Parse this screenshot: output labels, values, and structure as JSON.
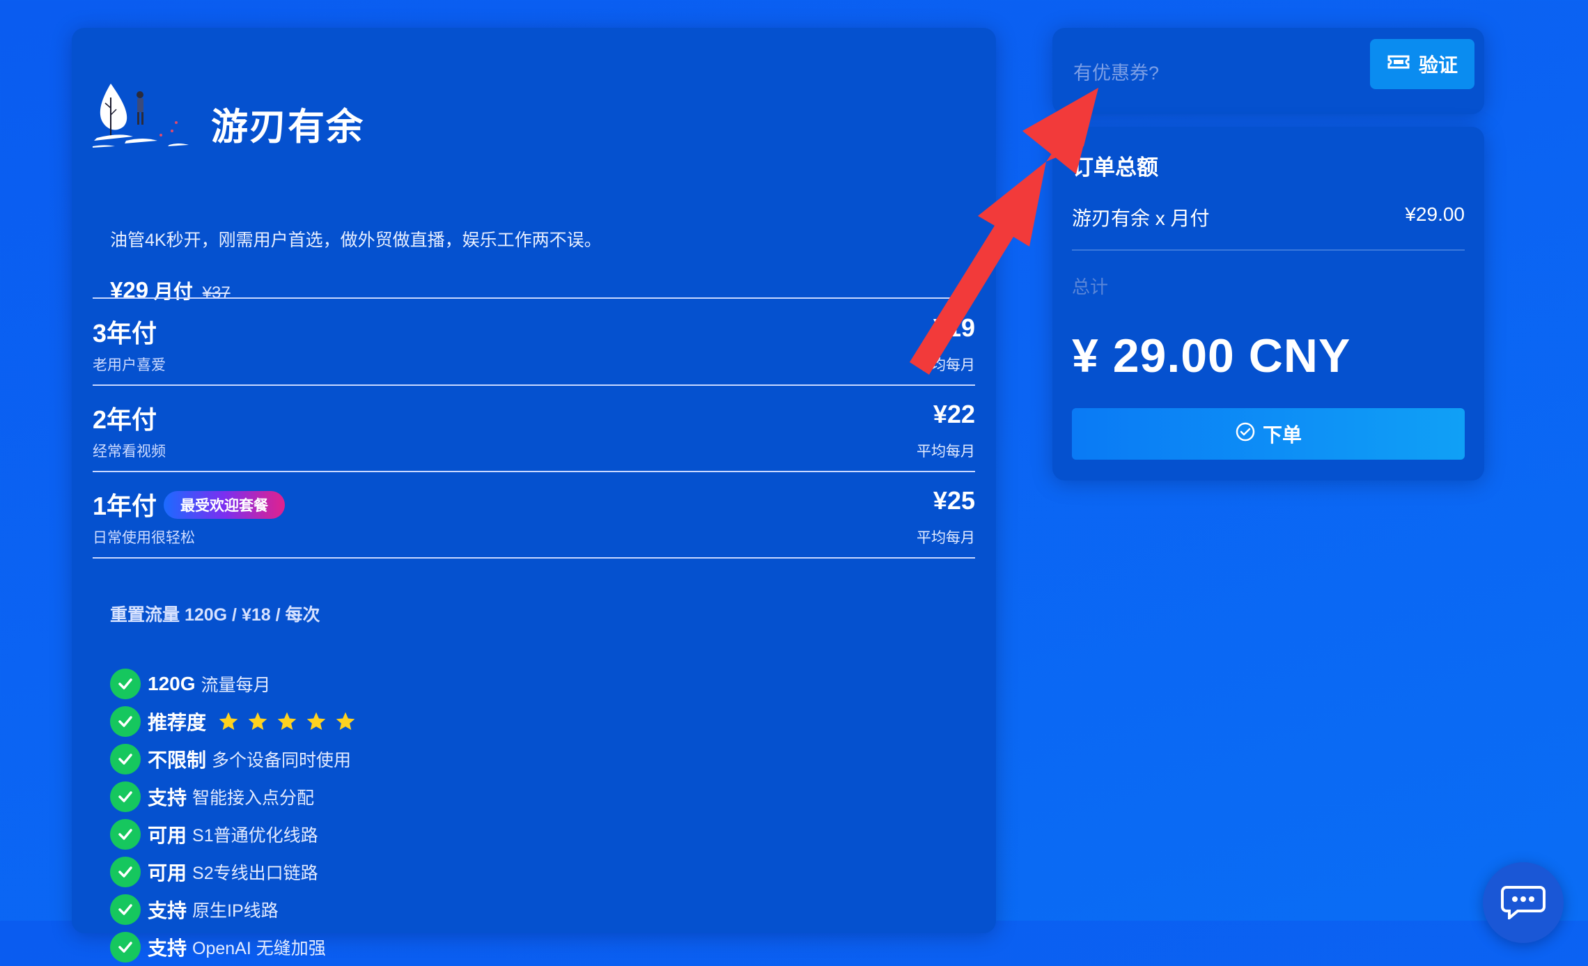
{
  "product": {
    "title": "游刃有余",
    "description": "油管4K秒开，刚需用户首选，做外贸做直播，娱乐工作两不误。",
    "price": "¥29",
    "period": "月付",
    "original_price": "¥37"
  },
  "plans": [
    {
      "name": "3年付",
      "subtitle": "老用户喜爱",
      "price": "¥19",
      "per": "平均每月"
    },
    {
      "name": "2年付",
      "subtitle": "经常看视频",
      "price": "¥22",
      "per": "平均每月"
    },
    {
      "name": "1年付",
      "badge": "最受欢迎套餐",
      "subtitle": "日常使用很轻松",
      "price": "¥25",
      "per": "平均每月"
    }
  ],
  "reset_traffic": "重置流量 120G / ¥18 / 每次",
  "features": [
    {
      "strong": "120G",
      "text": "流量每月"
    },
    {
      "strong": "推荐度",
      "text": "",
      "stars": 5
    },
    {
      "strong": "不限制",
      "text": "多个设备同时使用"
    },
    {
      "strong": "支持",
      "text": "智能接入点分配"
    },
    {
      "strong": "可用",
      "text": "S1普通优化线路"
    },
    {
      "strong": "可用",
      "text": "S2专线出口链路"
    },
    {
      "strong": "支持",
      "text": "原生IP线路"
    },
    {
      "strong": "支持",
      "text": "OpenAI 无缝加强"
    }
  ],
  "coupon": {
    "placeholder": "有优惠券?",
    "verify_label": "验证"
  },
  "order": {
    "title": "订单总额",
    "item": "游刃有余 x 月付",
    "item_price": "¥29.00",
    "total_label": "总计",
    "total_amount": "¥ 29.00 CNY",
    "submit_label": "下单"
  },
  "colors": {
    "background": "#0a5cf0",
    "panel": "#0551cf",
    "check": "#16c75e",
    "star": "#ffd21f",
    "button": "#0a8cf0",
    "arrow": "#f23a3a"
  }
}
